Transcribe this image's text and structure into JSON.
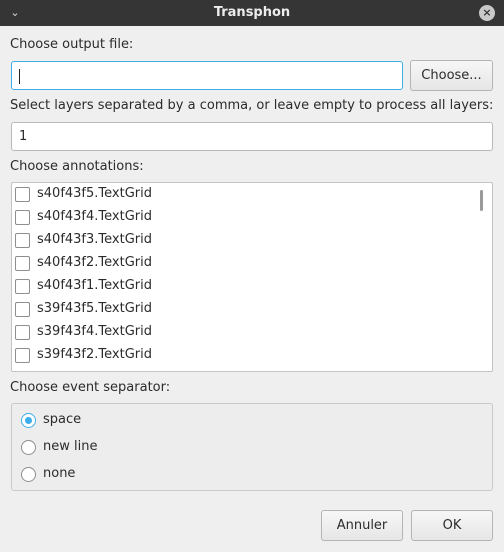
{
  "window": {
    "title": "Transphon",
    "menu_icon": "chevron-down-icon",
    "close_icon": "close-icon"
  },
  "output_file": {
    "label": "Choose output file:",
    "value": "",
    "browse_label": "Choose..."
  },
  "layers": {
    "label": "Select layers separated by a comma, or leave empty to process all layers:",
    "value": "1"
  },
  "annotations": {
    "label": "Choose annotations:",
    "items": [
      {
        "label": "s40f43f5.TextGrid",
        "checked": false
      },
      {
        "label": "s40f43f4.TextGrid",
        "checked": false
      },
      {
        "label": "s40f43f3.TextGrid",
        "checked": false
      },
      {
        "label": "s40f43f2.TextGrid",
        "checked": false
      },
      {
        "label": "s40f43f1.TextGrid",
        "checked": false
      },
      {
        "label": "s39f43f5.TextGrid",
        "checked": false
      },
      {
        "label": "s39f43f4.TextGrid",
        "checked": false
      },
      {
        "label": "s39f43f2.TextGrid",
        "checked": false
      }
    ]
  },
  "separator": {
    "label": "Choose event separator:",
    "options": [
      {
        "label": "space",
        "selected": true
      },
      {
        "label": "new line",
        "selected": false
      },
      {
        "label": "none",
        "selected": false
      }
    ]
  },
  "buttons": {
    "cancel_label": "Annuler",
    "ok_label": "OK"
  },
  "colors": {
    "accent": "#3daee9",
    "titlebar": "#353535",
    "background": "#efefef"
  }
}
